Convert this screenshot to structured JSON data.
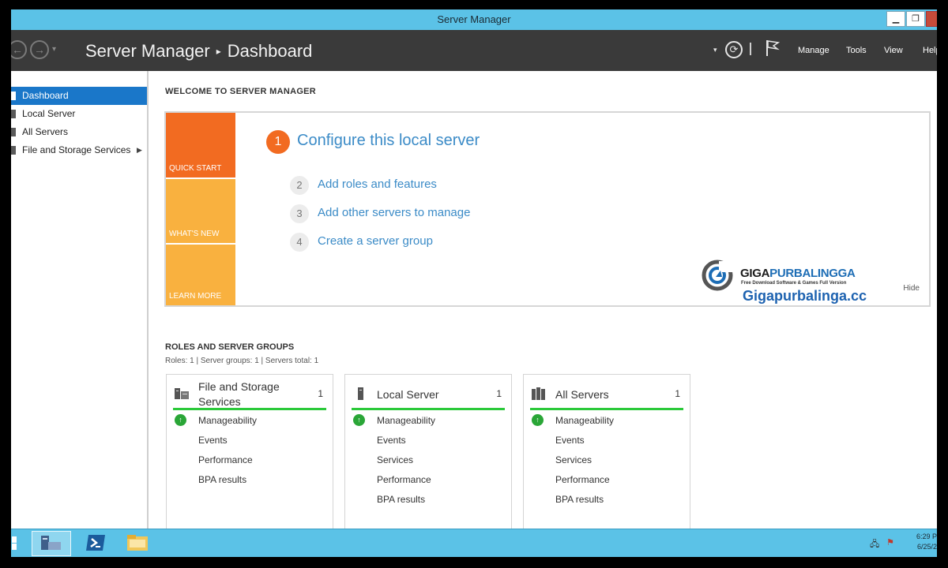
{
  "window": {
    "title": "Server Manager"
  },
  "header": {
    "app": "Server Manager",
    "page": "Dashboard",
    "menu": [
      "Manage",
      "Tools",
      "View",
      "Help"
    ]
  },
  "sidebar": {
    "items": [
      {
        "label": "Dashboard",
        "active": true
      },
      {
        "label": "Local Server"
      },
      {
        "label": "All Servers"
      },
      {
        "label": "File and Storage Services",
        "has_submenu": true
      }
    ]
  },
  "welcome": {
    "heading": "WELCOME TO SERVER MANAGER",
    "tiles": [
      "QUICK START",
      "WHAT'S NEW",
      "LEARN MORE"
    ],
    "steps": [
      {
        "num": "1",
        "label": "Configure this local server"
      },
      {
        "num": "2",
        "label": "Add roles and features"
      },
      {
        "num": "3",
        "label": "Add other servers to manage"
      },
      {
        "num": "4",
        "label": "Create a server group"
      }
    ],
    "hide": "Hide"
  },
  "watermark": {
    "brand_a": "GIGA",
    "brand_b": "PURBALINGGA",
    "tagline": "Free Download Software & Games Full Version",
    "url": "Gigapurbalinga.cc"
  },
  "roles": {
    "heading": "ROLES AND SERVER GROUPS",
    "summary": "Roles: 1   |   Server groups: 1   |   Servers total: 1",
    "cards": [
      {
        "title_line1": "File and Storage",
        "title_line2": "Services",
        "count": "1",
        "rows": [
          "Manageability",
          "Events",
          "Performance",
          "BPA results"
        ]
      },
      {
        "title": "Local Server",
        "count": "1",
        "rows": [
          "Manageability",
          "Events",
          "Services",
          "Performance",
          "BPA results"
        ]
      },
      {
        "title": "All Servers",
        "count": "1",
        "rows": [
          "Manageability",
          "Events",
          "Services",
          "Performance",
          "BPA results"
        ]
      }
    ]
  },
  "taskbar": {
    "time": "6:29 P",
    "date": "6/25/2"
  },
  "colors": {
    "accent": "#1a77c9",
    "title_bar": "#5bc2e7",
    "quick_start": "#f26b21",
    "tile": "#f9b13f",
    "ok": "#2bc93a"
  }
}
